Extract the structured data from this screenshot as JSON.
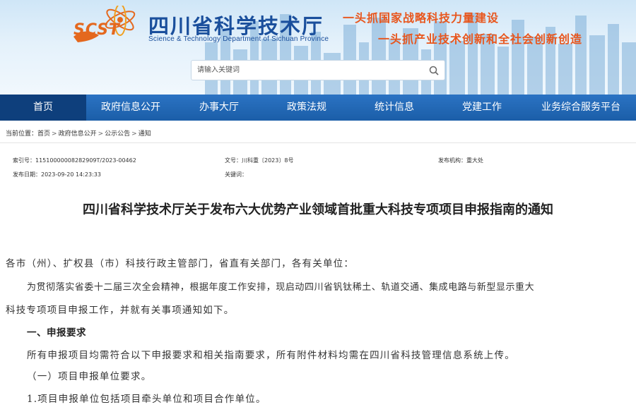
{
  "header": {
    "logo_text": "SCST",
    "site_title": "四川省科学技术厅",
    "site_subtitle": "Science & Technology Department of Sichuan Province",
    "slogan_1": "一头抓国家战略科技力量建设",
    "slogan_2": "一头抓产业技术创新和全社会创新创造",
    "search_placeholder": "请输入关键词"
  },
  "nav": {
    "items": [
      {
        "label": "首页",
        "active": true
      },
      {
        "label": "政府信息公开"
      },
      {
        "label": "办事大厅"
      },
      {
        "label": "政策法规"
      },
      {
        "label": "统计信息"
      },
      {
        "label": "党建工作"
      },
      {
        "label": "业务综合服务平台"
      }
    ]
  },
  "breadcrumb": {
    "label": "当前位置：",
    "items": [
      "首页",
      "政府信息公开",
      "公示公告",
      "通知"
    ],
    "separator": ">"
  },
  "meta": {
    "index_no": "索引号：11510000008282909T/2023-00462",
    "doc_no": "文号：川科重〔2023〕8号",
    "publisher": "发布机构：重大处",
    "publish_date": "发布日期：2023-09-20 14:23:33",
    "keywords": "关键词："
  },
  "article": {
    "title": "四川省科学技术厅关于发布六大优势产业领域首批重大科技专项项目申报指南的通知",
    "salutation": "各市（州）、扩权县（市）科技行政主管部门，省直有关部门，各有关单位：",
    "p1_line1": "为贯彻落实省委十二届三次全会精神，根据年度工作安排，现启动四川省钒钛稀土、轨道交通、集成电路与新型显示重大",
    "p1_line2": "科技专项项目申报工作，并就有关事项通知如下。",
    "h1": "一、申报要求",
    "p2": "所有申报项目均需符合以下申报要求和相关指南要求，所有附件材料均需在四川省科技管理信息系统上传。",
    "sub1": "（一）项目申报单位要求。",
    "item1": "1.项目申报单位包括项目牵头单位和项目合作单位。"
  },
  "colors": {
    "nav_bg": "#1b5ea8",
    "nav_active": "#0e3f7c",
    "title_blue": "#1a4f9c",
    "slogan_orange": "#e8561d"
  }
}
